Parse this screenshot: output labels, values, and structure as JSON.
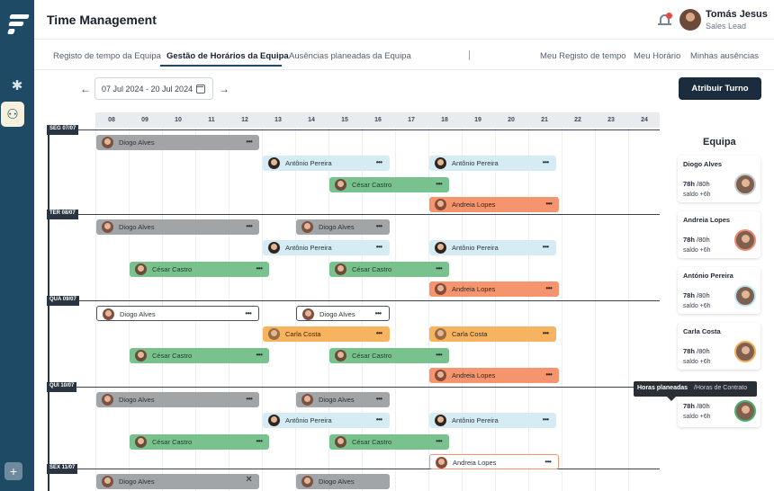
{
  "app": {
    "title": "Time Management"
  },
  "user": {
    "name": "Tomás Jesus",
    "role": "Sales Lead"
  },
  "tabs": [
    {
      "label": "Registo de tempo da Equipa",
      "active": false
    },
    {
      "label": "Gestão de Horários da Equipa",
      "active": true
    },
    {
      "label": "Ausências planeadas da Equipa",
      "active": false
    },
    {
      "label": "Meu Registo de tempo",
      "active": false
    },
    {
      "label": "Meu Horário",
      "active": false
    },
    {
      "label": "Minhas ausências",
      "active": false
    }
  ],
  "tab_separator": "|",
  "toolbar": {
    "date_range": "07 Jul 2024 - 20 Jul 2024",
    "prev_icon": "arrow-left-icon",
    "next_icon": "arrow-right-icon",
    "calendar_icon": "calendar-icon",
    "assign_label": "Atribuir Turno"
  },
  "schedule": {
    "hours": [
      "08",
      "09",
      "10",
      "11",
      "12",
      "13",
      "14",
      "15",
      "16",
      "17",
      "18",
      "19",
      "20",
      "21",
      "22",
      "23",
      "24"
    ],
    "days": [
      {
        "label": "SEG 07/07"
      },
      {
        "label": "TER 08/07"
      },
      {
        "label": "QUA 09/07"
      },
      {
        "label": "QUI 10/07"
      },
      {
        "label": "SEX 11/07"
      }
    ],
    "shifts": [
      {
        "name": "Diogo Alves",
        "start": 8.0,
        "end": 12.9,
        "day": 0,
        "row": 0,
        "style": "grey",
        "action": "menu"
      },
      {
        "name": "Antônio Pereira",
        "start": 13.0,
        "end": 16.8,
        "day": 0,
        "row": 1,
        "style": "blue",
        "action": "menu"
      },
      {
        "name": "Antônio Pereira",
        "start": 18.0,
        "end": 21.8,
        "day": 0,
        "row": 1,
        "style": "blue",
        "action": "menu"
      },
      {
        "name": "César Castro",
        "start": 15.0,
        "end": 18.6,
        "day": 0,
        "row": 2,
        "style": "green",
        "action": "menu"
      },
      {
        "name": "Andreia Lopes",
        "start": 18.0,
        "end": 21.9,
        "day": 0,
        "row": 3,
        "style": "orange",
        "action": "menu"
      },
      {
        "name": "Diogo Alves",
        "start": 8.0,
        "end": 12.9,
        "day": 1,
        "row": 0,
        "style": "grey",
        "action": "menu"
      },
      {
        "name": "Diogo Alves",
        "start": 14.0,
        "end": 16.8,
        "day": 1,
        "row": 0,
        "style": "grey",
        "action": "menu"
      },
      {
        "name": "Antônio Pereira",
        "start": 13.0,
        "end": 16.8,
        "day": 1,
        "row": 1,
        "style": "blue",
        "action": "menu"
      },
      {
        "name": "Antônio Pereira",
        "start": 18.0,
        "end": 21.8,
        "day": 1,
        "row": 1,
        "style": "blue",
        "action": "menu"
      },
      {
        "name": "César Castro",
        "start": 9.0,
        "end": 13.2,
        "day": 1,
        "row": 2,
        "style": "green",
        "action": "menu"
      },
      {
        "name": "César Castro",
        "start": 15.0,
        "end": 18.6,
        "day": 1,
        "row": 2,
        "style": "green",
        "action": "menu"
      },
      {
        "name": "Andreia Lopes",
        "start": 18.0,
        "end": 21.9,
        "day": 1,
        "row": 3,
        "style": "orange",
        "action": "menu"
      },
      {
        "name": "Diogo Alves",
        "start": 8.0,
        "end": 12.9,
        "day": 2,
        "row": 0,
        "style": "outline",
        "action": "menu"
      },
      {
        "name": "Diogo Alves",
        "start": 14.0,
        "end": 16.8,
        "day": 2,
        "row": 0,
        "style": "outline",
        "action": "menu"
      },
      {
        "name": "Carla Costa",
        "start": 13.0,
        "end": 16.8,
        "day": 2,
        "row": 1,
        "style": "amber",
        "action": "menu"
      },
      {
        "name": "Carla Costa",
        "start": 18.0,
        "end": 21.8,
        "day": 2,
        "row": 1,
        "style": "amber",
        "action": "menu"
      },
      {
        "name": "César Castro",
        "start": 9.0,
        "end": 13.2,
        "day": 2,
        "row": 2,
        "style": "green",
        "action": "menu"
      },
      {
        "name": "César Castro",
        "start": 15.0,
        "end": 18.6,
        "day": 2,
        "row": 2,
        "style": "green",
        "action": "menu"
      },
      {
        "name": "Andreia Lopes",
        "start": 18.0,
        "end": 21.9,
        "day": 2,
        "row": 3,
        "style": "orange",
        "action": "menu"
      },
      {
        "name": "Diogo Alves",
        "start": 8.0,
        "end": 12.9,
        "day": 3,
        "row": 0,
        "style": "grey",
        "action": "menu"
      },
      {
        "name": "Diogo Alves",
        "start": 14.0,
        "end": 16.8,
        "day": 3,
        "row": 0,
        "style": "grey",
        "action": "menu"
      },
      {
        "name": "Antônio Pereira",
        "start": 13.0,
        "end": 16.8,
        "day": 3,
        "row": 1,
        "style": "blue",
        "action": "menu"
      },
      {
        "name": "Antônio Pereira",
        "start": 18.0,
        "end": 21.8,
        "day": 3,
        "row": 1,
        "style": "blue",
        "action": "menu"
      },
      {
        "name": "César Castro",
        "start": 9.0,
        "end": 13.2,
        "day": 3,
        "row": 2,
        "style": "green",
        "action": "menu"
      },
      {
        "name": "César Castro",
        "start": 15.0,
        "end": 18.6,
        "day": 3,
        "row": 2,
        "style": "green",
        "action": "menu"
      },
      {
        "name": "Andreia Lopes",
        "start": 18.0,
        "end": 21.9,
        "day": 3,
        "row": 3,
        "style": "outline-orange",
        "action": "menu"
      },
      {
        "name": "Diogo Alves",
        "start": 8.0,
        "end": 12.9,
        "day": 4,
        "row": 0,
        "style": "grey",
        "action": "close"
      },
      {
        "name": "Diogo Alves",
        "start": 14.0,
        "end": 16.8,
        "day": 4,
        "row": 0,
        "style": "grey",
        "action": "none"
      }
    ],
    "menu_glyph": "•••",
    "close_glyph": "✕"
  },
  "team": {
    "title": "Equipa",
    "members": [
      {
        "name": "Diogo Alves",
        "hours": "78h",
        "contract": " /80h",
        "balance": "saldo +6h",
        "avatar_icon": "avatar-diogo",
        "ring": "#c9c9c9"
      },
      {
        "name": "Andreia Lopes",
        "hours": "78h",
        "contract": " /80h",
        "balance": "saldo +6h",
        "avatar_icon": "avatar-andreia",
        "ring": "#f08a6e"
      },
      {
        "name": "António Pereira",
        "hours": "78h",
        "contract": " /80h",
        "balance": "saldo +6h",
        "avatar_icon": "avatar-antonio",
        "ring": "#bfe3ef"
      },
      {
        "name": "Carla Costa",
        "hours": "78h",
        "contract": " /80h",
        "balance": "saldo +6h",
        "avatar_icon": "avatar-carla",
        "ring": "#f4ad58"
      },
      {
        "name": "",
        "hours": "78h",
        "contract": " /80h",
        "balance": "saldo +6h",
        "avatar_icon": "avatar-cesar",
        "ring": "#4caf6d"
      }
    ]
  },
  "tooltip": {
    "title": "Horas planeadas",
    "subtitle": "/Horas de Contrato"
  },
  "colors": {
    "rail": "#1e4a66",
    "grey": "#a2a5a8",
    "blue": "#d5ecf4",
    "green": "#79c28f",
    "orange": "#f4956f",
    "amber": "#f7b35f",
    "primary_button": "#1a2c3d"
  }
}
